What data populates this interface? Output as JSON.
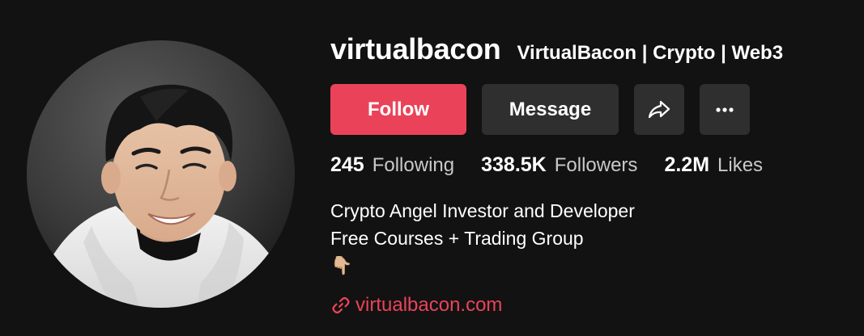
{
  "profile": {
    "username": "virtualbacon",
    "nickname": "VirtualBacon | Crypto | Web3"
  },
  "buttons": {
    "follow_label": "Follow",
    "message_label": "Message",
    "share_icon": "share-icon",
    "more_icon": "more-icon"
  },
  "stats": [
    {
      "value": "245",
      "label": "Following"
    },
    {
      "value": "338.5K",
      "label": "Followers"
    },
    {
      "value": "2.2M",
      "label": "Likes"
    }
  ],
  "bio": {
    "lines": [
      "Crypto Angel Investor and Developer",
      "Free Courses + Trading Group"
    ],
    "emoji": "👇🏼"
  },
  "link": {
    "text": "virtualbacon.com",
    "icon": "link-icon"
  },
  "colors": {
    "background": "#121212",
    "accent": "#ea4359",
    "button_secondary": "#2f2f2f",
    "muted_text": "#c9c9c9"
  }
}
